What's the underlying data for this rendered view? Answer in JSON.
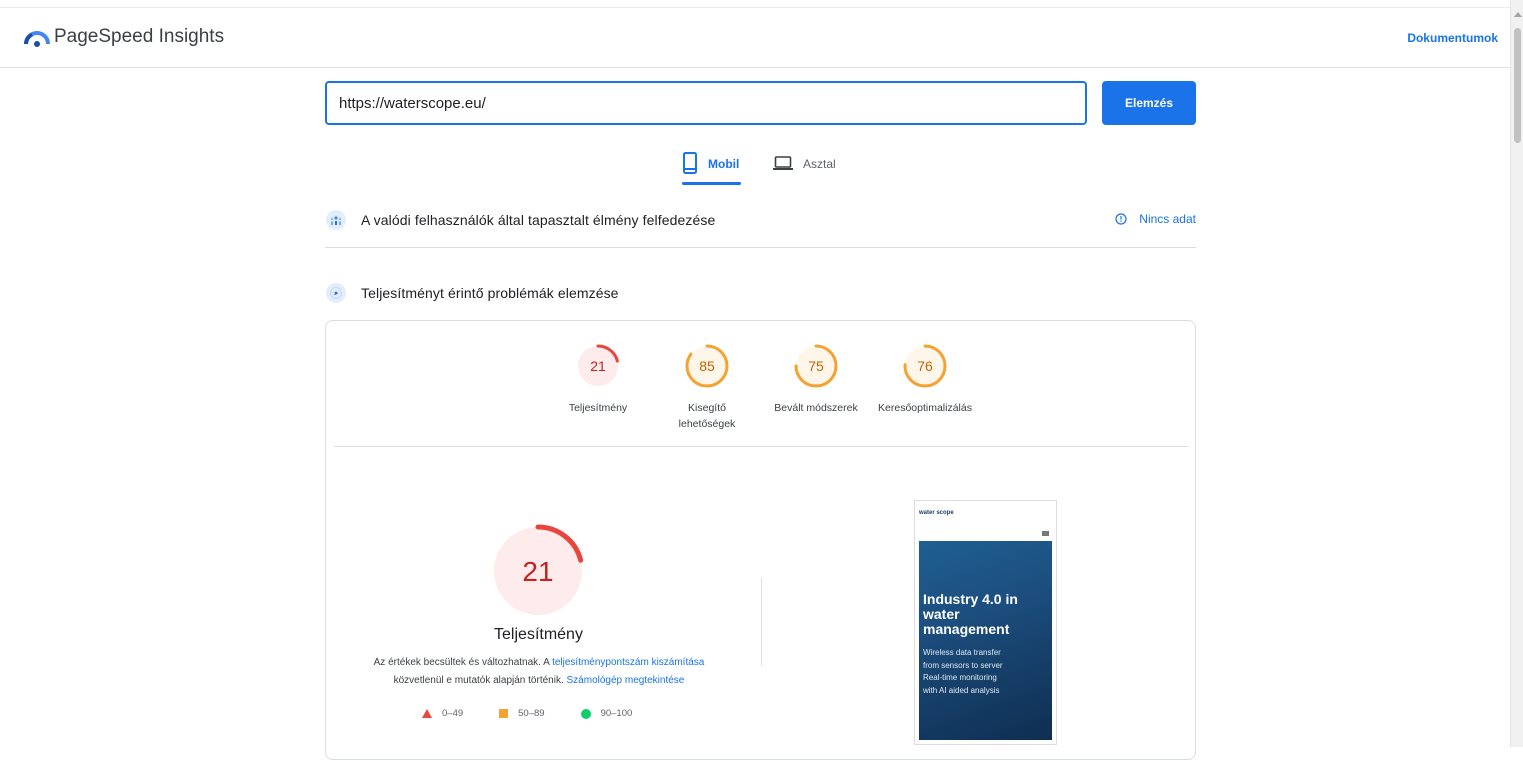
{
  "header": {
    "brand": "PageSpeed Insights",
    "docs_link": "Dokumentumok"
  },
  "search": {
    "url_value": "https://waterscope.eu/",
    "analyze_label": "Elemzés"
  },
  "tabs": [
    {
      "label": "Mobil",
      "icon": "smartphone-icon",
      "active": true
    },
    {
      "label": "Asztal",
      "icon": "laptop-icon",
      "active": false
    }
  ],
  "field_data": {
    "title": "A valódi felhasználók által tapasztalt élmény felfedezése",
    "status": "Nincs adat",
    "status_icon": "info-icon"
  },
  "lab_data": {
    "title": "Teljesítményt érintő problémák elemzése"
  },
  "scores": [
    {
      "value": 21,
      "label": "Teljesítmény",
      "color": "#e8453c",
      "fill": "#fdeceb",
      "rating": "fail"
    },
    {
      "value": 85,
      "label": "Kisegítő lehetőségek",
      "color": "#f4a233",
      "fill": "#fff6ea",
      "rating": "average"
    },
    {
      "value": 75,
      "label": "Bevált módszerek",
      "color": "#f4a233",
      "fill": "#fff6ea",
      "rating": "average"
    },
    {
      "value": 76,
      "label": "Keresőoptimalizálás",
      "color": "#f4a233",
      "fill": "#fff6ea",
      "rating": "average"
    }
  ],
  "performance_detail": {
    "score": 21,
    "title": "Teljesítmény",
    "desc_part1": "Az értékek becsültek és változhatnak. A ",
    "desc_link1": "teljesítménypontszám kiszámítása",
    "desc_part2": " közvetlenül e mutatók alapján történik. ",
    "desc_link2": "Számológép megtekintése"
  },
  "legend": [
    {
      "range": "0–49",
      "shape": "triangle",
      "color": "#e8453c"
    },
    {
      "range": "50–89",
      "shape": "square",
      "color": "#f4a233"
    },
    {
      "range": "90–100",
      "shape": "circle",
      "color": "#0cce6b"
    }
  ],
  "screenshot": {
    "logo_text": "water scope",
    "hero_title": "Industry 4.0 in water management",
    "hero_line1": "Wireless data transfer",
    "hero_line2": "from sensors to server",
    "hero_line3": "Real-time monitoring",
    "hero_line4": "with AI aided analysis"
  },
  "colors": {
    "accent": "#1a73e8",
    "fail": "#e8453c",
    "average": "#f4a233",
    "pass": "#0cce6b"
  }
}
